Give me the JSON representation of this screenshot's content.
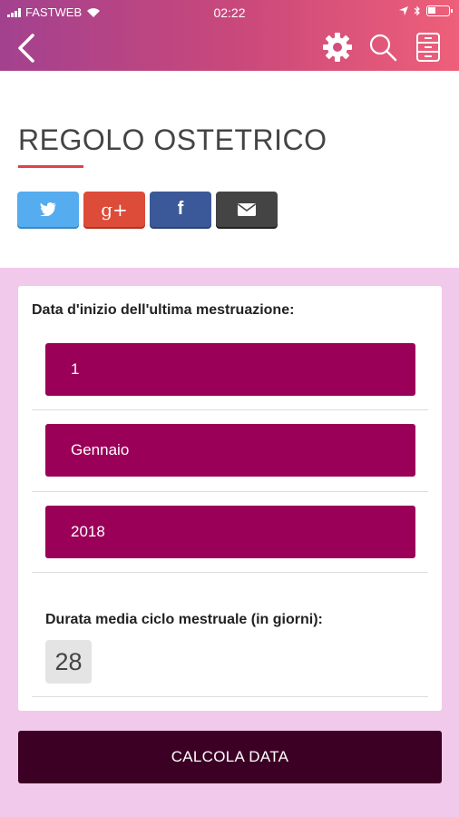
{
  "status": {
    "carrier": "FASTWEB",
    "time": "02:22"
  },
  "nav": {
    "icons": [
      "back-icon",
      "gear-icon",
      "search-icon",
      "archive-icon"
    ]
  },
  "page": {
    "title": "REGOLO OSTETRICO"
  },
  "share": {
    "icons": [
      "twitter-icon",
      "google-plus-icon",
      "facebook-icon",
      "email-icon"
    ]
  },
  "form": {
    "last_period_label": "Data d'inizio dell'ultima mestruazione:",
    "day": "1",
    "month": "Gennaio",
    "year": "2018",
    "cycle_label": "Durata media ciclo mestruale (in giorni):",
    "cycle_value": "28"
  },
  "calc_button": "CALCOLA DATA",
  "colors": {
    "field_bg": "#9a0058",
    "button_bg": "#3c0024",
    "page_bg": "#f1c9ea",
    "accent": "#e0404f"
  }
}
